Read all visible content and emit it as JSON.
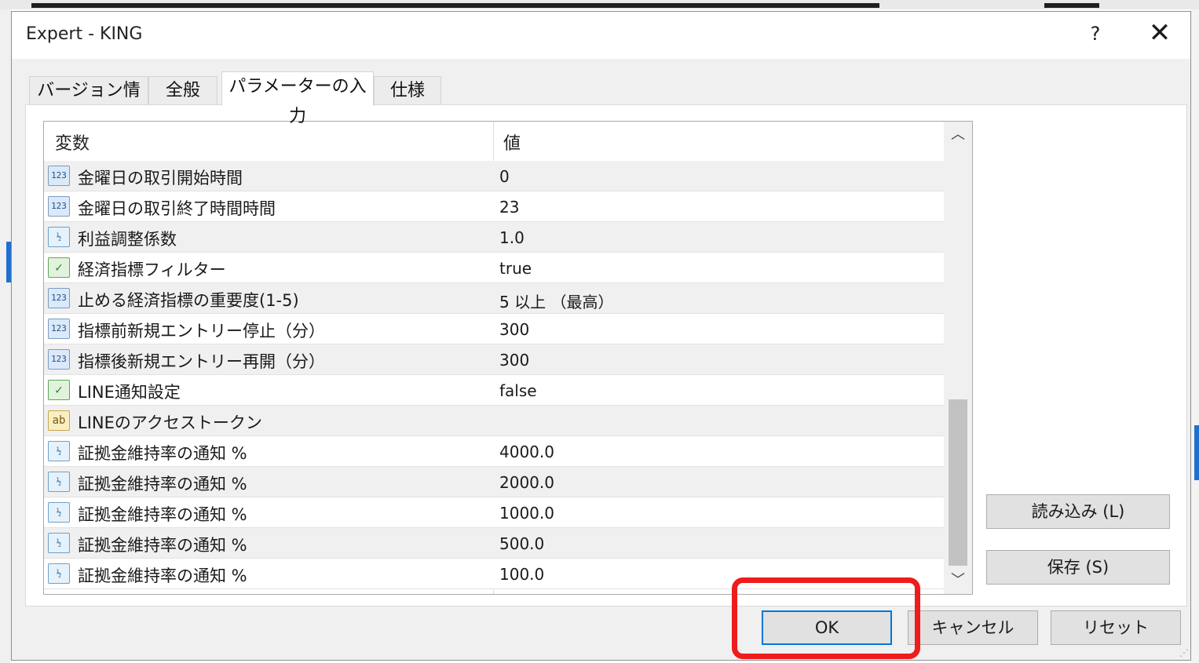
{
  "window": {
    "title": "Expert - KING",
    "help_label": "?",
    "close_label": "✕"
  },
  "tabs": [
    {
      "label": "バージョン情報"
    },
    {
      "label": "全般"
    },
    {
      "label": "パラメーターの入力",
      "active": true
    },
    {
      "label": "仕様"
    }
  ],
  "grid": {
    "header_variable": "変数",
    "header_value": "値",
    "rows": [
      {
        "icon": "123",
        "name": "金曜日の取引開始時間",
        "value": "0"
      },
      {
        "icon": "123",
        "name": "金曜日の取引終了時間時間",
        "value": "23"
      },
      {
        "icon": "v2",
        "name": "利益調整係数",
        "value": "1.0"
      },
      {
        "icon": "bool",
        "name": "経済指標フィルター",
        "value": "true"
      },
      {
        "icon": "123",
        "name": "止める経済指標の重要度(1-5)",
        "value": "5 以上 （最高）"
      },
      {
        "icon": "123",
        "name": "指標前新規エントリー停止（分）",
        "value": "300"
      },
      {
        "icon": "123",
        "name": "指標後新規エントリー再開（分）",
        "value": "300"
      },
      {
        "icon": "bool",
        "name": "LINE通知設定",
        "value": "false"
      },
      {
        "icon": "ab",
        "name": "LINEのアクセストークン",
        "value": ""
      },
      {
        "icon": "v2",
        "name": "証拠金維持率の通知 %",
        "value": "4000.0"
      },
      {
        "icon": "v2",
        "name": "証拠金維持率の通知 %",
        "value": "2000.0"
      },
      {
        "icon": "v2",
        "name": "証拠金維持率の通知 %",
        "value": "1000.0"
      },
      {
        "icon": "v2",
        "name": "証拠金維持率の通知 %",
        "value": "500.0"
      },
      {
        "icon": "v2",
        "name": "証拠金維持率の通知 %",
        "value": "100.0"
      }
    ]
  },
  "side_buttons": {
    "load": "読み込み (L)",
    "save": "保存 (S)"
  },
  "bottom_buttons": {
    "ok": "OK",
    "cancel": "キャンセル",
    "reset": "リセット"
  },
  "icon_glyphs": {
    "123": "123",
    "v2": "½",
    "bool": "✓",
    "ab": "ab"
  },
  "colors": {
    "highlight": "#ee1c1c",
    "default_button_border": "#0078d7"
  }
}
